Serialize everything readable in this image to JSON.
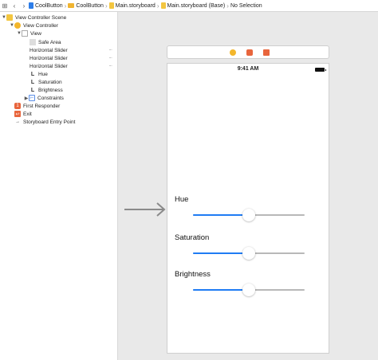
{
  "jumpbar": {
    "crumbs": [
      "CoolButton",
      "CoolButton",
      "Main.storyboard",
      "Main.storyboard (Base)",
      "No Selection"
    ]
  },
  "outline": {
    "items": [
      {
        "label": "View Controller Scene",
        "icon": "scene-icon",
        "expanded": true
      },
      {
        "label": "View Controller",
        "icon": "view-controller-icon",
        "expanded": true
      },
      {
        "label": "View",
        "icon": "view-icon",
        "expanded": true
      },
      {
        "label": "Safe Area",
        "icon": "safe-area-icon"
      },
      {
        "label": "Horizontal Slider",
        "icon": "slider-icon"
      },
      {
        "label": "Horizontal Slider",
        "icon": "slider-icon"
      },
      {
        "label": "Horizontal Slider",
        "icon": "slider-icon"
      },
      {
        "label": "Hue",
        "icon": "label-icon"
      },
      {
        "label": "Saturation",
        "icon": "label-icon"
      },
      {
        "label": "Brightness",
        "icon": "label-icon"
      },
      {
        "label": "Constraints",
        "icon": "constraints-icon",
        "expanded": false
      },
      {
        "label": "First Responder",
        "icon": "first-responder-icon"
      },
      {
        "label": "Exit",
        "icon": "exit-icon"
      },
      {
        "label": "Storyboard Entry Point",
        "icon": "entry-arrow-icon"
      }
    ]
  },
  "device": {
    "status_time": "9:41 AM",
    "controls": [
      {
        "label": "Hue",
        "value": 0.5
      },
      {
        "label": "Saturation",
        "value": 0.5
      },
      {
        "label": "Brightness",
        "value": 0.5
      }
    ]
  },
  "colors": {
    "slider_fill": "#1f7cf4",
    "slider_track": "#b8b8b8",
    "canvas_bg": "#e9e9e9",
    "vc_icon": "#f3b62b",
    "responder_icon": "#e8653c"
  }
}
